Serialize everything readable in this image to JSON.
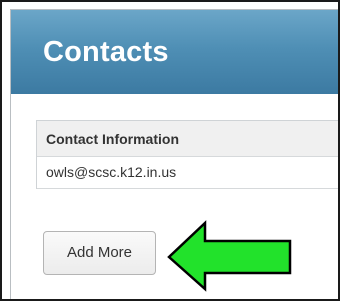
{
  "header": {
    "title": "Contacts"
  },
  "table": {
    "column_header": "Contact Information",
    "rows": [
      {
        "value": "owls@scsc.k12.in.us"
      }
    ]
  },
  "actions": {
    "add_more_label": "Add More"
  },
  "annotation": {
    "arrow_color": "#22e22b",
    "arrow_outline_color": "#000000",
    "arrow_icon": "left-arrow-icon"
  },
  "theme": {
    "header_color": "#4f8fb5"
  }
}
